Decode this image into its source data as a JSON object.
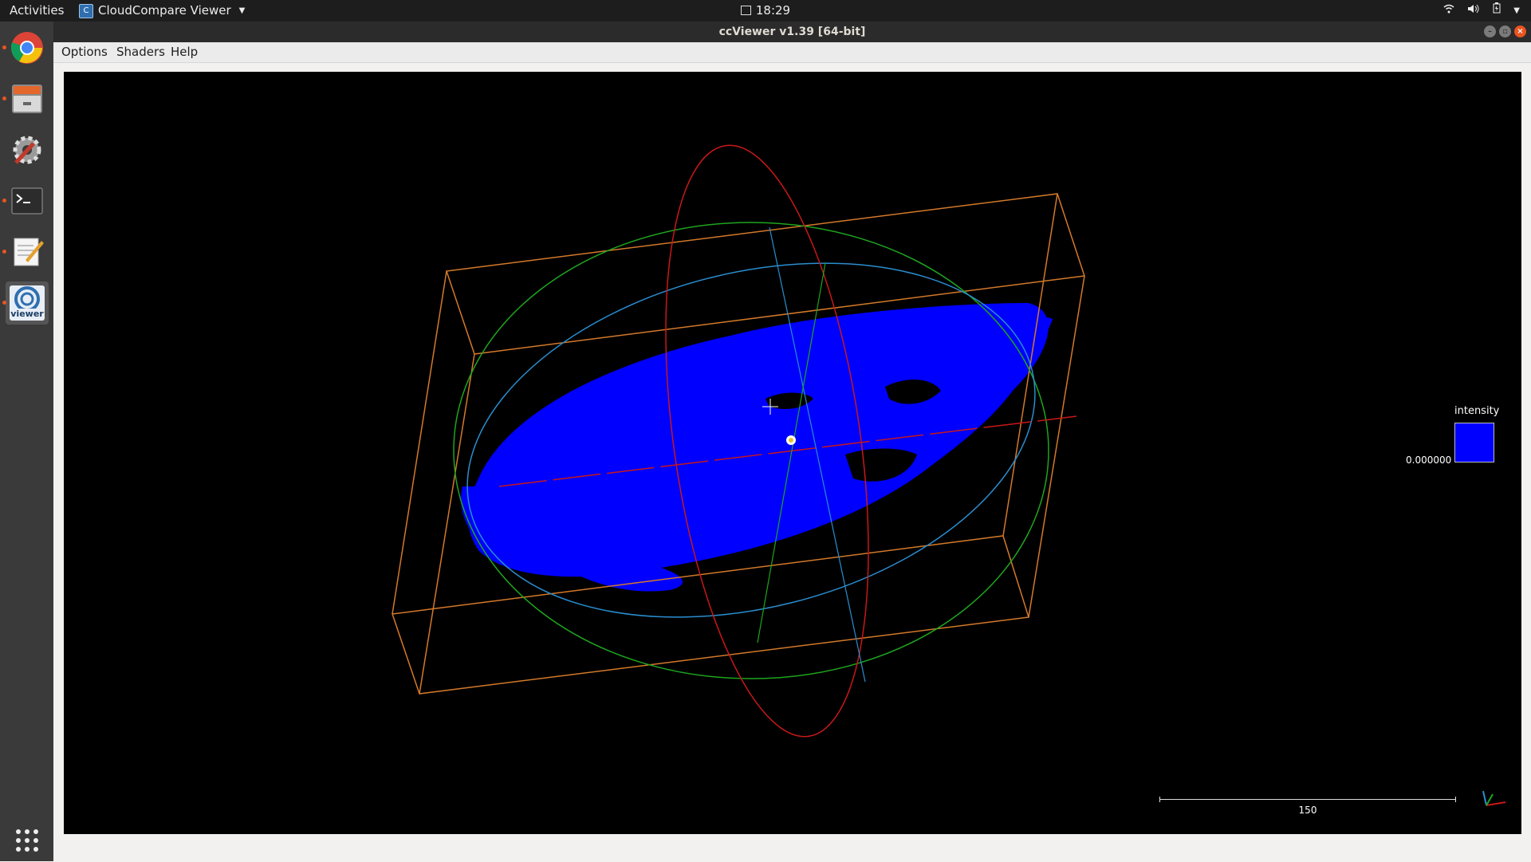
{
  "topbar": {
    "activities": "Activities",
    "app_name": "CloudCompare Viewer",
    "clock": "18:29"
  },
  "launcher": {
    "items": [
      {
        "name": "chrome"
      },
      {
        "name": "files"
      },
      {
        "name": "settings"
      },
      {
        "name": "terminal"
      },
      {
        "name": "text-editor"
      },
      {
        "name": "ccviewer",
        "label": "viewer"
      }
    ]
  },
  "window": {
    "title": "ccViewer v1.39 [64-bit]"
  },
  "menu": {
    "options": "Options",
    "shaders": "Shaders",
    "help": "Help"
  },
  "viewport": {
    "legend_title": "intensity",
    "legend_value": "0.000000",
    "legend_color": "#0000ff",
    "scale_value": "150"
  },
  "colors": {
    "bbox": "#d4792a",
    "sphere_green": "#1ea51e",
    "sphere_red": "#c81818",
    "sphere_blue": "#2a8ed0",
    "points": "#0000ff"
  }
}
